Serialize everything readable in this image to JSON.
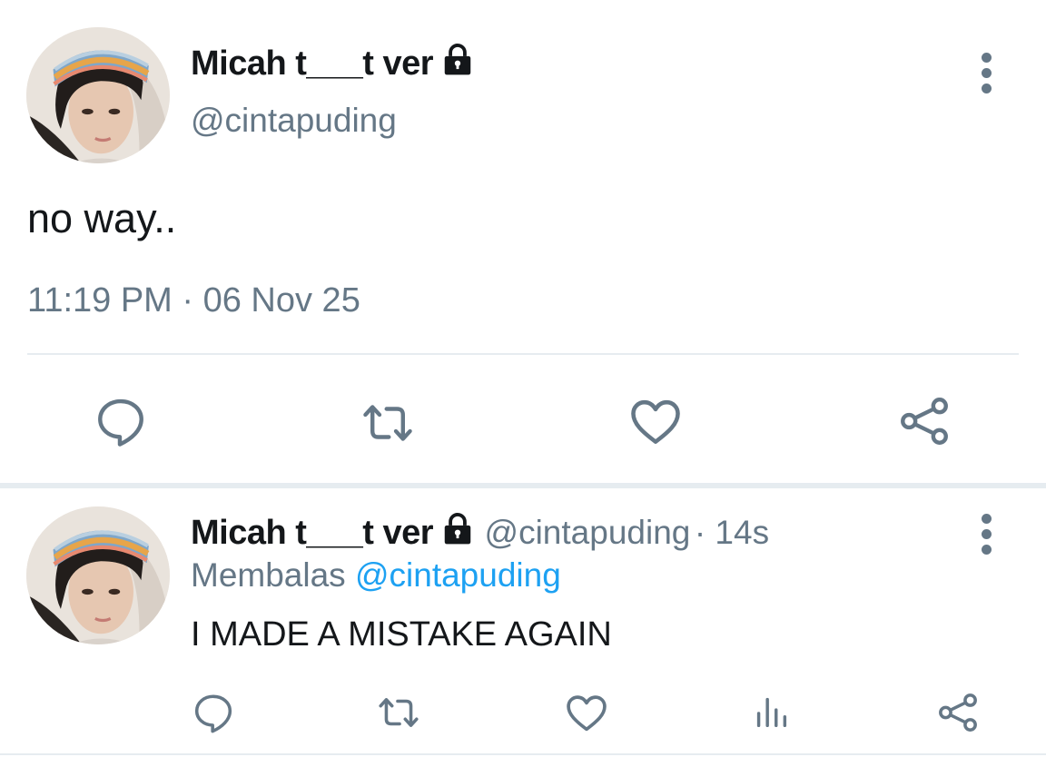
{
  "main_tweet": {
    "display_name": "Micah t___t ver",
    "handle": "@cintapuding",
    "text": "no way..",
    "timestamp": "11:19 PM · 06 Nov 25",
    "actions": [
      "reply-icon",
      "retweet-icon",
      "like-icon",
      "share-icon"
    ]
  },
  "reply_tweet": {
    "display_name": "Micah t___t ver",
    "handle": "@cintapuding",
    "time_ago": "· 14s",
    "replying_prefix": "Membalas",
    "replying_to": "@cintapuding",
    "text": "I MADE A MISTAKE AGAIN",
    "actions": [
      "reply-icon",
      "retweet-icon",
      "like-icon",
      "analytics-icon",
      "share-icon"
    ]
  },
  "colors": {
    "icon_gray": "#657786",
    "link_blue": "#1da1f2",
    "divider": "#e6ecf0"
  }
}
